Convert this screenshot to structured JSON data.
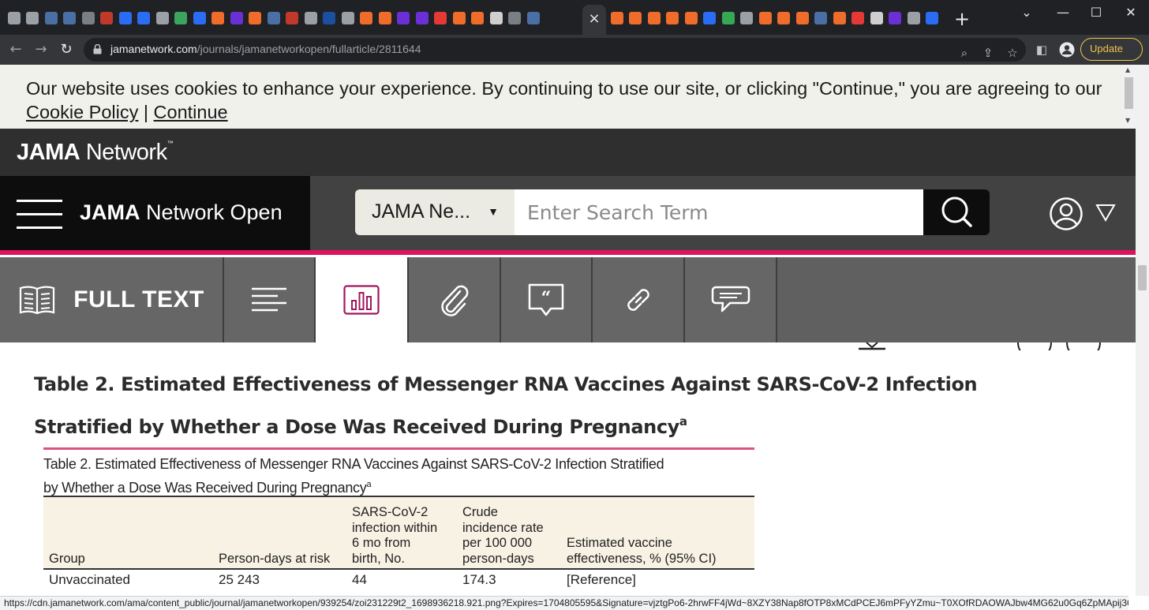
{
  "browser": {
    "url_host": "jamanetwork.com",
    "url_path": "/journals/jamanetworkopen/fullarticle/2811644",
    "update_label": "Update",
    "close_tab_glyph": "×",
    "new_tab_glyph": "+",
    "tab_favicon_colors": [
      "#9aa0a6",
      "#9aa0a6",
      "#4a6fa5",
      "#4a6fa5",
      "#7a7f85",
      "#c0392b",
      "#2a6df4",
      "#2a6df4",
      "#9aa0a6",
      "#3ba55d",
      "#2a6df4",
      "#f06c2b",
      "#6b2fd6",
      "#f06c2b",
      "#4a6fa5",
      "#c0392b",
      "#9aa0a6",
      "#1c4fa0",
      "#9aa0a6",
      "#f06c2b",
      "#f06c2b",
      "#6b2fd6",
      "#6b2fd6",
      "#e53935",
      "#f06c2b",
      "#f06c2b",
      "#cfcfcf",
      "#7a7f85",
      "#4a6fa5"
    ],
    "tab_favicon_colors_right": [
      "#f06c2b",
      "#f06c2b",
      "#f06c2b",
      "#f06c2b",
      "#f06c2b",
      "#2a6df4",
      "#34a853",
      "#9aa0a6",
      "#f06c2b",
      "#f06c2b",
      "#f06c2b",
      "#4a6fa5",
      "#f06c2b",
      "#e53935",
      "#cfcfcf",
      "#6b2fd6",
      "#9aa0a6",
      "#2a6df4"
    ],
    "status_url": "https://cdn.jamanetwork.com/ama/content_public/journal/jamanetworkopen/939254/zoi231229t2_1698936218.921.png?Expires=1704805595&Signature=vjztgPo6-2hrwFF4jWd~8XZY38Nap8fOTP8xMCdPCEJ6mPFyYZmu~T0XOfRDAOWAJbw4MG62u0Gq6ZpMApij3Q27mB6TBTY..."
  },
  "cookie_banner": {
    "text": "Our website uses cookies to enhance your experience. By continuing to use our site, or clicking \"Continue,\" you are agreeing to our ",
    "policy_link": "Cookie Policy",
    "separator": " | ",
    "continue_link": "Continue"
  },
  "network_bar": {
    "logo_bold": "JAMA",
    "logo_rest": " Network",
    "logo_tm": "™"
  },
  "site_header": {
    "brand_bold": "JAMA",
    "brand_rest": " Network Open",
    "search_scope": "JAMA Ne...",
    "search_placeholder": "Enter Search Term"
  },
  "toolbar": {
    "fulltext_label": "FULL TEXT"
  },
  "article": {
    "title": "Table 2.  Estimated Effectiveness of Messenger RNA Vaccines Against SARS-CoV-2 Infection Stratified by Whether a Dose Was Received During Pregnancy",
    "title_sup": "a"
  },
  "table_image": {
    "title_line1": "Table 2. Estimated Effectiveness of Messenger RNA Vaccines Against SARS-CoV-2 Infection Stratified",
    "title_line2": "by Whether a Dose Was Received During Pregnancy",
    "title_sup": "a",
    "headers": {
      "group": "Group",
      "person_days": "Person-days at risk",
      "infections_1": "SARS-CoV-2",
      "infections_2": "infection within",
      "infections_3": "6 mo from",
      "infections_4": "birth, No.",
      "crude_1": "Crude",
      "crude_2": "incidence rate",
      "crude_3": "per 100 000",
      "crude_4": "person-days",
      "ve_1": "Estimated vaccine",
      "ve_2": "effectiveness, % (95% CI)"
    },
    "rows": [
      {
        "group": "Unvaccinated",
        "person_days": "25 243",
        "infections": "44",
        "crude_rate": "174.3",
        "effectiveness": "[Reference]"
      }
    ]
  }
}
